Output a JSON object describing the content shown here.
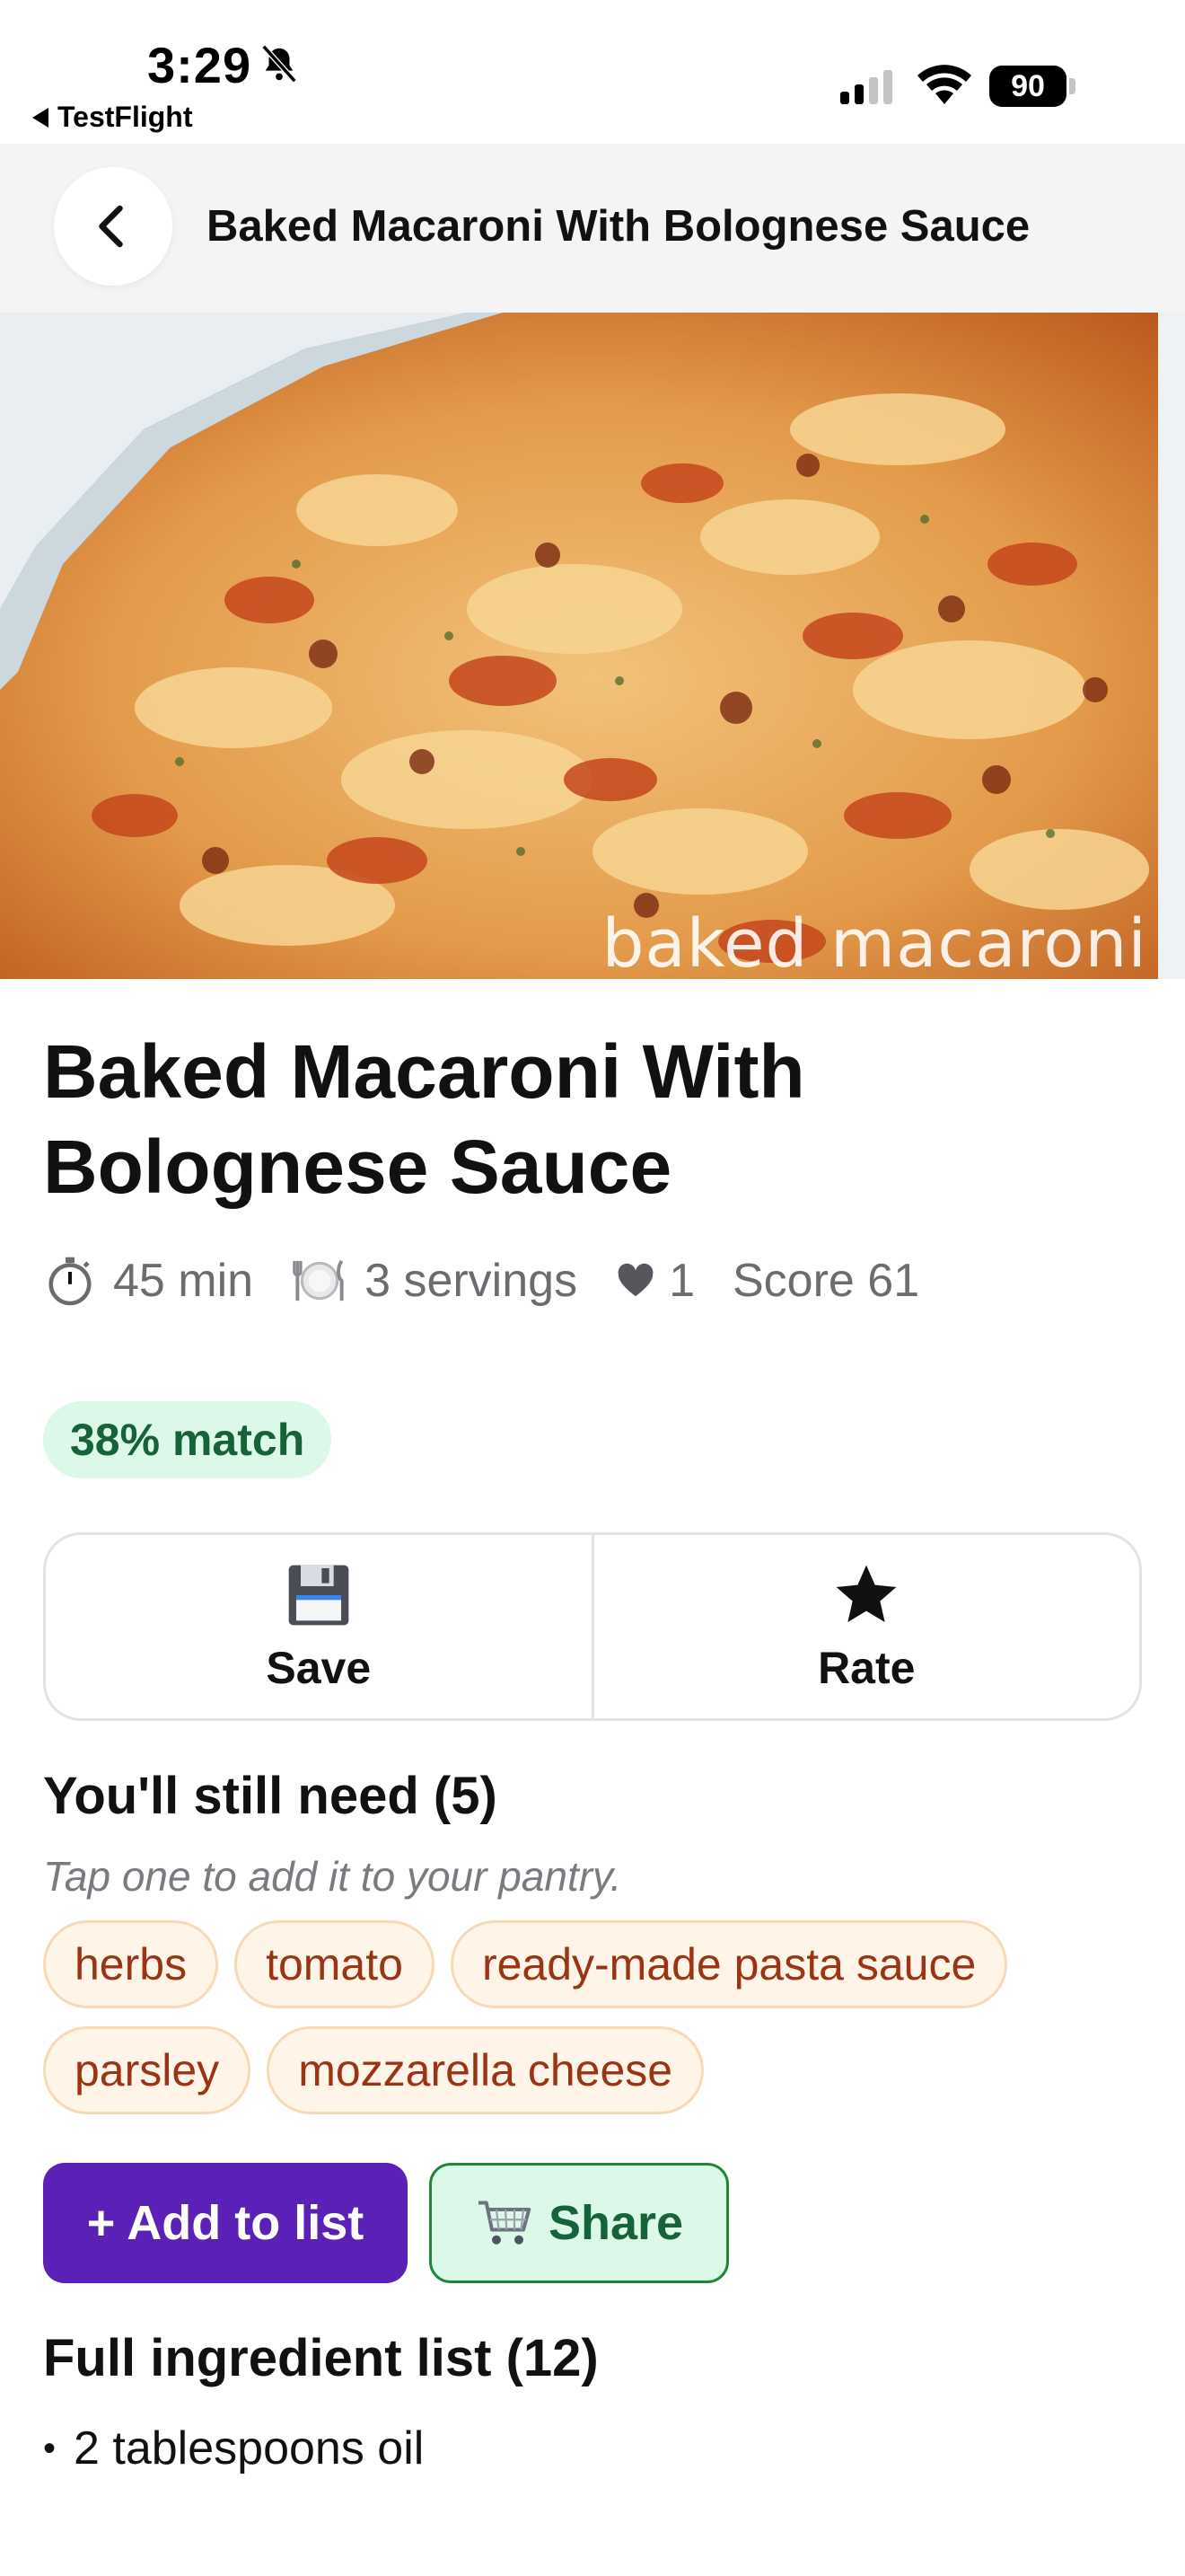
{
  "status_bar": {
    "time": "3:29",
    "back_app": "TestFlight",
    "battery": "90",
    "icons": [
      "bell-slash-icon",
      "signal-icon",
      "wifi-icon",
      "battery-icon"
    ]
  },
  "header": {
    "title": "Baked Macaroni With Bolognese Sauce",
    "back_icon": "chevron-left-icon"
  },
  "hero": {
    "watermark": "baked macaroni"
  },
  "recipe": {
    "title": "Baked Macaroni With Bolognese Sauce",
    "time": "45 min",
    "servings": "3 servings",
    "likes": "1",
    "score": "Score 61",
    "match": "38% match"
  },
  "actions": {
    "save_label": "Save",
    "save_icon": "floppy-disk-icon",
    "rate_label": "Rate",
    "rate_icon": "star-icon"
  },
  "still_need": {
    "title": "You'll still need (5)",
    "hint": "Tap one to add it to your pantry.",
    "items": [
      "herbs",
      "tomato",
      "ready-made pasta sauce",
      "parsley",
      "mozzarella cheese"
    ]
  },
  "list_buttons": {
    "add_label": "+ Add to list",
    "share_label": "Share",
    "share_icon": "shopping-cart-icon"
  },
  "full_list": {
    "title": "Full ingredient list (12)",
    "items": [
      "2 tablespoons oil"
    ]
  },
  "colors": {
    "accent_purple": "#5b21b6",
    "match_green_bg": "#dcf8e8",
    "match_green_text": "#16633a",
    "chip_bg": "#fff4e8",
    "chip_text": "#9a3412"
  }
}
